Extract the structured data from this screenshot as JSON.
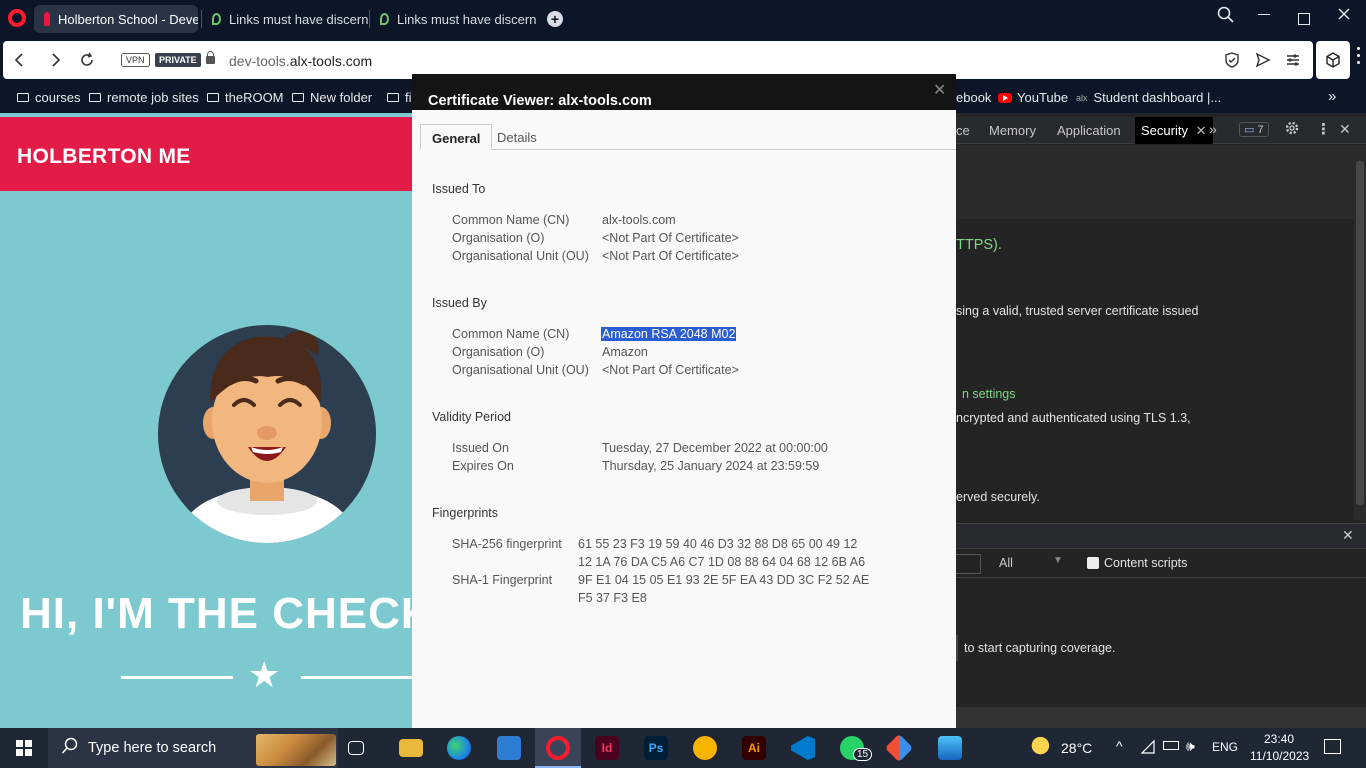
{
  "browser": {
    "tabs": [
      {
        "title": "Holberton School - Devel"
      },
      {
        "title": "Links must have discernib"
      },
      {
        "title": "Links must have discernib"
      }
    ],
    "new_tab": "+",
    "address": {
      "vpn": "VPN",
      "private": "PRIVATE",
      "url_prefix": "dev-tools.",
      "url_domain": "alx-tools.com"
    },
    "bookmarks": [
      {
        "label": "courses"
      },
      {
        "label": "remote job sites"
      },
      {
        "label": "theROOM"
      },
      {
        "label": "New folder"
      },
      {
        "label": "fir"
      },
      {
        "label": "ebook"
      },
      {
        "label": "YouTube"
      },
      {
        "label": "Student dashboard |..."
      }
    ],
    "bookmark_alx": "alx"
  },
  "page": {
    "brand": "HOLBERTON ME",
    "hero": "HI, I'M THE CHECKER"
  },
  "devtools": {
    "tabs": [
      "ce",
      "Memory",
      "Application",
      "Security"
    ],
    "issues_count": "7",
    "lines": [
      "TTPS).",
      "sing a valid, trusted server certificate issued",
      "n settings",
      "ncrypted and authenticated using TLS 1.3,",
      "erved securely."
    ],
    "filter_all": "All",
    "content_scripts": "Content scripts",
    "coverage_text": "to start capturing coverage."
  },
  "certificate": {
    "title": "Certificate Viewer: alx-tools.com",
    "tabs": [
      "General",
      "Details"
    ],
    "issued_to": {
      "heading": "Issued To",
      "rows": [
        {
          "label": "Common Name (CN)",
          "value": "alx-tools.com"
        },
        {
          "label": "Organisation (O)",
          "value": "<Not Part Of Certificate>"
        },
        {
          "label": "Organisational Unit (OU)",
          "value": "<Not Part Of Certificate>"
        }
      ]
    },
    "issued_by": {
      "heading": "Issued By",
      "rows": [
        {
          "label": "Common Name (CN)",
          "value": "Amazon RSA 2048 M02"
        },
        {
          "label": "Organisation (O)",
          "value": "Amazon"
        },
        {
          "label": "Organisational Unit (OU)",
          "value": "<Not Part Of Certificate>"
        }
      ]
    },
    "validity": {
      "heading": "Validity Period",
      "rows": [
        {
          "label": "Issued On",
          "value": "Tuesday, 27 December 2022 at 00:00:00"
        },
        {
          "label": "Expires On",
          "value": "Thursday, 25 January 2024 at 23:59:59"
        }
      ]
    },
    "fingerprints": {
      "heading": "Fingerprints",
      "sha256_label": "SHA-256 fingerprint",
      "sha256_line1": "61 55 23 F3 19 59 40 46 D3 32 88 D8 65 00 49 12",
      "sha256_line2": "12 1A 76 DA C5 A6 C7 1D 08 88 64 04 68 12 6B A6",
      "sha1_label": "SHA-1 Fingerprint",
      "sha1_line1": "9F E1 04 15 05 E1 93 2E 5F EA 43 DD 3C F2 52 AE",
      "sha1_line2": "F5 37 F3 E8"
    }
  },
  "taskbar": {
    "search_placeholder": "Type here to search",
    "whatsapp_badge": "15",
    "weather": "28°C",
    "language": "ENG",
    "time": "23:40",
    "date": "11/10/2023",
    "apps": {
      "indesign": "Id",
      "photoshop": "Ps",
      "illustrator": "Ai"
    }
  }
}
